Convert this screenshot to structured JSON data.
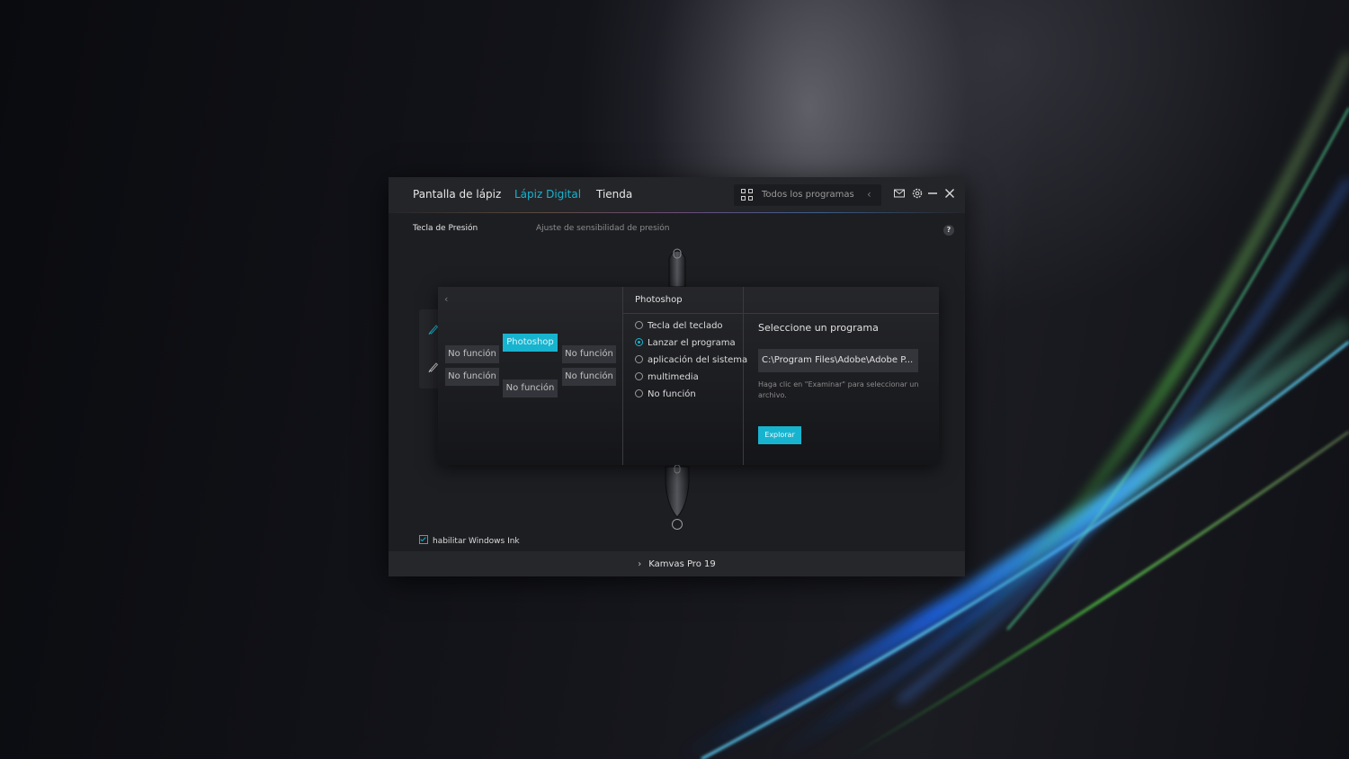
{
  "colors": {
    "accent": "#18b4cf",
    "window_bg": "#1d1e22",
    "popup_bg": "#26272b"
  },
  "nav": {
    "tabs": [
      {
        "label": "Pantalla de lápiz",
        "active": false
      },
      {
        "label": "Lápiz Digital",
        "active": true
      },
      {
        "label": "Tienda",
        "active": false
      }
    ],
    "program_selector": {
      "icon": "grid-icon",
      "label": "Todos los programas"
    },
    "icons": [
      "mail-icon",
      "gear-icon",
      "minimize-icon",
      "close-icon"
    ]
  },
  "subheader": {
    "left": "Tecla de Presión",
    "middle": "Ajuste de sensibilidad de presión",
    "help": "?"
  },
  "popup": {
    "title": "Photoshop",
    "buttons": [
      {
        "label": "Photoshop",
        "active": true
      },
      {
        "label": "No función"
      },
      {
        "label": "No función"
      },
      {
        "label": "No función"
      },
      {
        "label": "No función"
      },
      {
        "label": "No función"
      }
    ],
    "options": [
      {
        "label": "Tecla del teclado",
        "selected": false
      },
      {
        "label": "Lanzar el programa",
        "selected": true
      },
      {
        "label": "aplicación del sistema",
        "selected": false
      },
      {
        "label": "multimedia",
        "selected": false
      },
      {
        "label": "No función",
        "selected": false
      }
    ],
    "select_title": "Seleccione un programa",
    "path_value": "C:\\Program Files\\Adobe\\Adobe P...",
    "hint": "Haga clic en \"Examinar\" para seleccionar un archivo.",
    "explore_button": "Explorar"
  },
  "windows_ink": {
    "label": "habilitar Windows Ink",
    "checked": true
  },
  "footer": {
    "device": "Kamvas Pro 19"
  }
}
